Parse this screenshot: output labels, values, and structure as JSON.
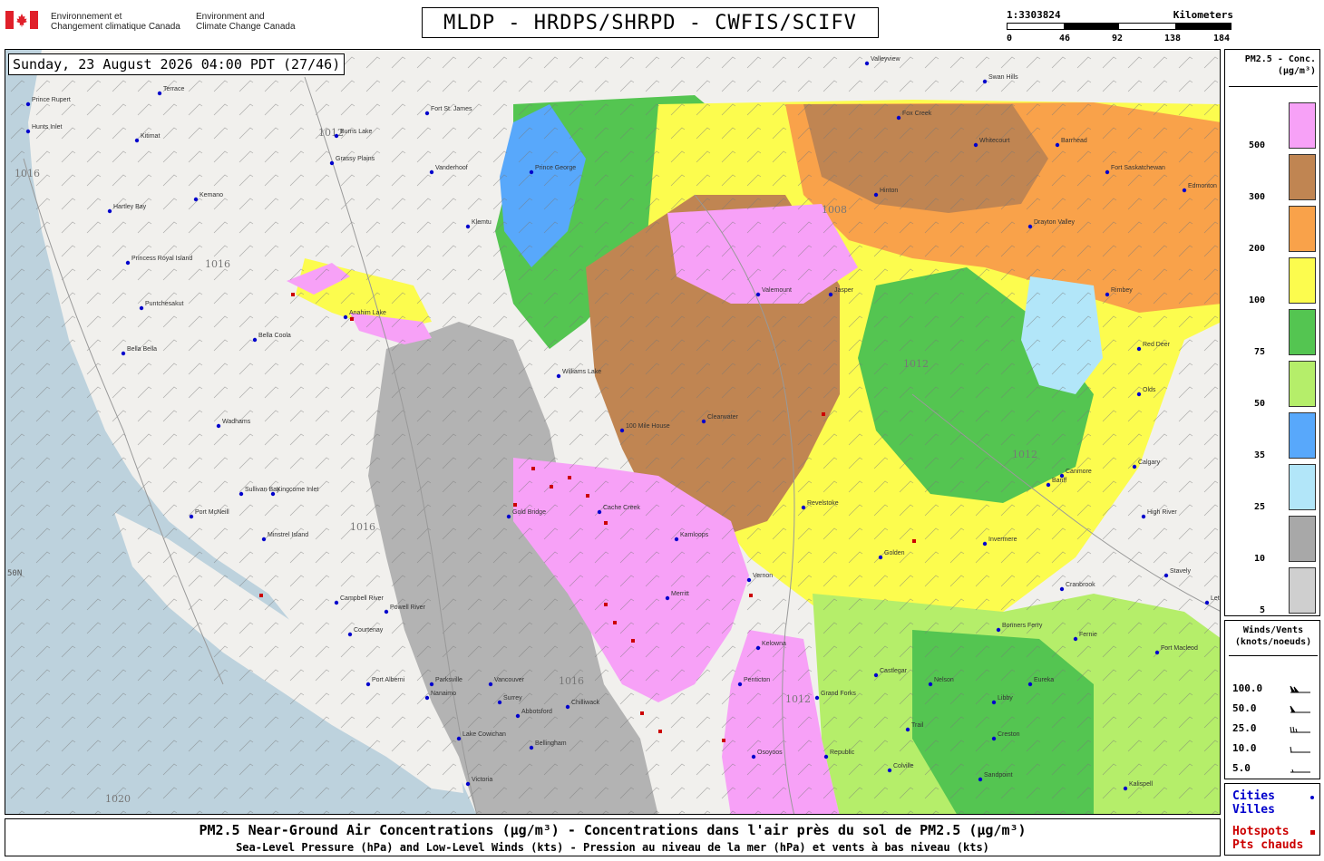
{
  "header": {
    "gov_fr_line1": "Environnement et",
    "gov_fr_line2": "Changement climatique Canada",
    "gov_en_line1": "Environment and",
    "gov_en_line2": "Climate Change Canada",
    "title": "MLDP - HRDPS/SHRPD - CWFIS/SCIFV",
    "scale_ratio": "1:3303824",
    "scale_units": "Kilometers",
    "scale_ticks": [
      "0",
      "46",
      "92",
      "138",
      "184"
    ]
  },
  "timestamp": "Sunday, 23 August 2026 04:00 PDT (27/46)",
  "legend_conc": {
    "title_line1": "PM2.5 - Conc.",
    "title_line2": "(µg/m³)",
    "levels": [
      {
        "label": "500",
        "color": "#f7a1f7"
      },
      {
        "label": "300",
        "color": "#c08552"
      },
      {
        "label": "200",
        "color": "#f9a24a"
      },
      {
        "label": "100",
        "color": "#fcfc4e"
      },
      {
        "label": "75",
        "color": "#54c551"
      },
      {
        "label": "50",
        "color": "#b5ee6a"
      },
      {
        "label": "35",
        "color": "#58a8fb"
      },
      {
        "label": "25",
        "color": "#b2e6f9"
      },
      {
        "label": "10",
        "color": "#a8a8a8"
      },
      {
        "label": "5",
        "color": "#cfcfcf"
      }
    ]
  },
  "legend_wind": {
    "title_line1": "Winds/Vents",
    "title_line2": "(knots/noeuds)",
    "values": [
      "100.0",
      "50.0",
      "25.0",
      "10.0",
      "5.0"
    ]
  },
  "legend_points": {
    "cities_en": "Cities",
    "cities_fr": "Villes",
    "hotspots_en": "Hotspots",
    "hotspots_fr": "Pts chauds",
    "city_color": "#0000cc",
    "hotspot_color": "#cc0000"
  },
  "map": {
    "isobars": [
      "1012",
      "1016",
      "1008",
      "1020",
      "1012",
      "1016",
      "1012",
      "1016",
      "1012",
      "1016"
    ],
    "lat_label": "50N",
    "cities": [
      "Prince Rupert",
      "Terrace",
      "Kitimat",
      "Hunts Inlet",
      "Burns Lake",
      "Fort St. James",
      "Grassy Plains",
      "Vanderhoof",
      "Prince George",
      "Kemano",
      "Hartley Bay",
      "Princess Royal Island",
      "Puntchesakut",
      "Klemtu",
      "Bella Coola",
      "Anahim Lake",
      "Bella Bella",
      "Williams Lake",
      "Wadhams",
      "Kingcome Inlet",
      "Sullivan Bay",
      "Port McNeill",
      "Minstrel Island",
      "Campbell River",
      "Powell River",
      "Courtenay",
      "Port Alberni",
      "Parksville",
      "Nanaimo",
      "Vancouver",
      "Surrey",
      "Chilliwack",
      "Abbotsford",
      "Lake Cowichan",
      "Bellingham",
      "Victoria",
      "100 Mile House",
      "Clearwater",
      "Valemount",
      "Cache Creek",
      "Kamloops",
      "Merritt",
      "Gold Bridge",
      "Vernon",
      "Kelowna",
      "Penticton",
      "Osoyoos",
      "Grand Forks",
      "Revelstoke",
      "Golden",
      "Invermere",
      "Cranbrook",
      "Fernie",
      "Nelson",
      "Castlegar",
      "Trail",
      "Republic",
      "Colville",
      "Sandpoint",
      "Kalispell",
      "Calgary",
      "High River",
      "Banff",
      "Canmore",
      "Red Deer",
      "Edmonton",
      "Fort Saskatchewan",
      "Barrhead",
      "Whitecourt",
      "Fox Creek",
      "Swan Hills",
      "Drayton Valley",
      "Rimbey",
      "Olds",
      "Stavely",
      "Lethbridge",
      "Fort Macleod",
      "Eureka",
      "Libby",
      "Bonners Ferry",
      "Valleyview",
      "Hinton",
      "Jasper",
      "Creston"
    ]
  },
  "footer": {
    "line1": "PM2.5 Near-Ground Air Concentrations (µg/m³) - Concentrations dans l'air près du sol de PM2.5 (µg/m³)",
    "line2": "Sea-Level Pressure (hPa) and Low-Level Winds (kts) - Pression au niveau de la mer (hPa) et vents à bas niveau (kts)"
  }
}
